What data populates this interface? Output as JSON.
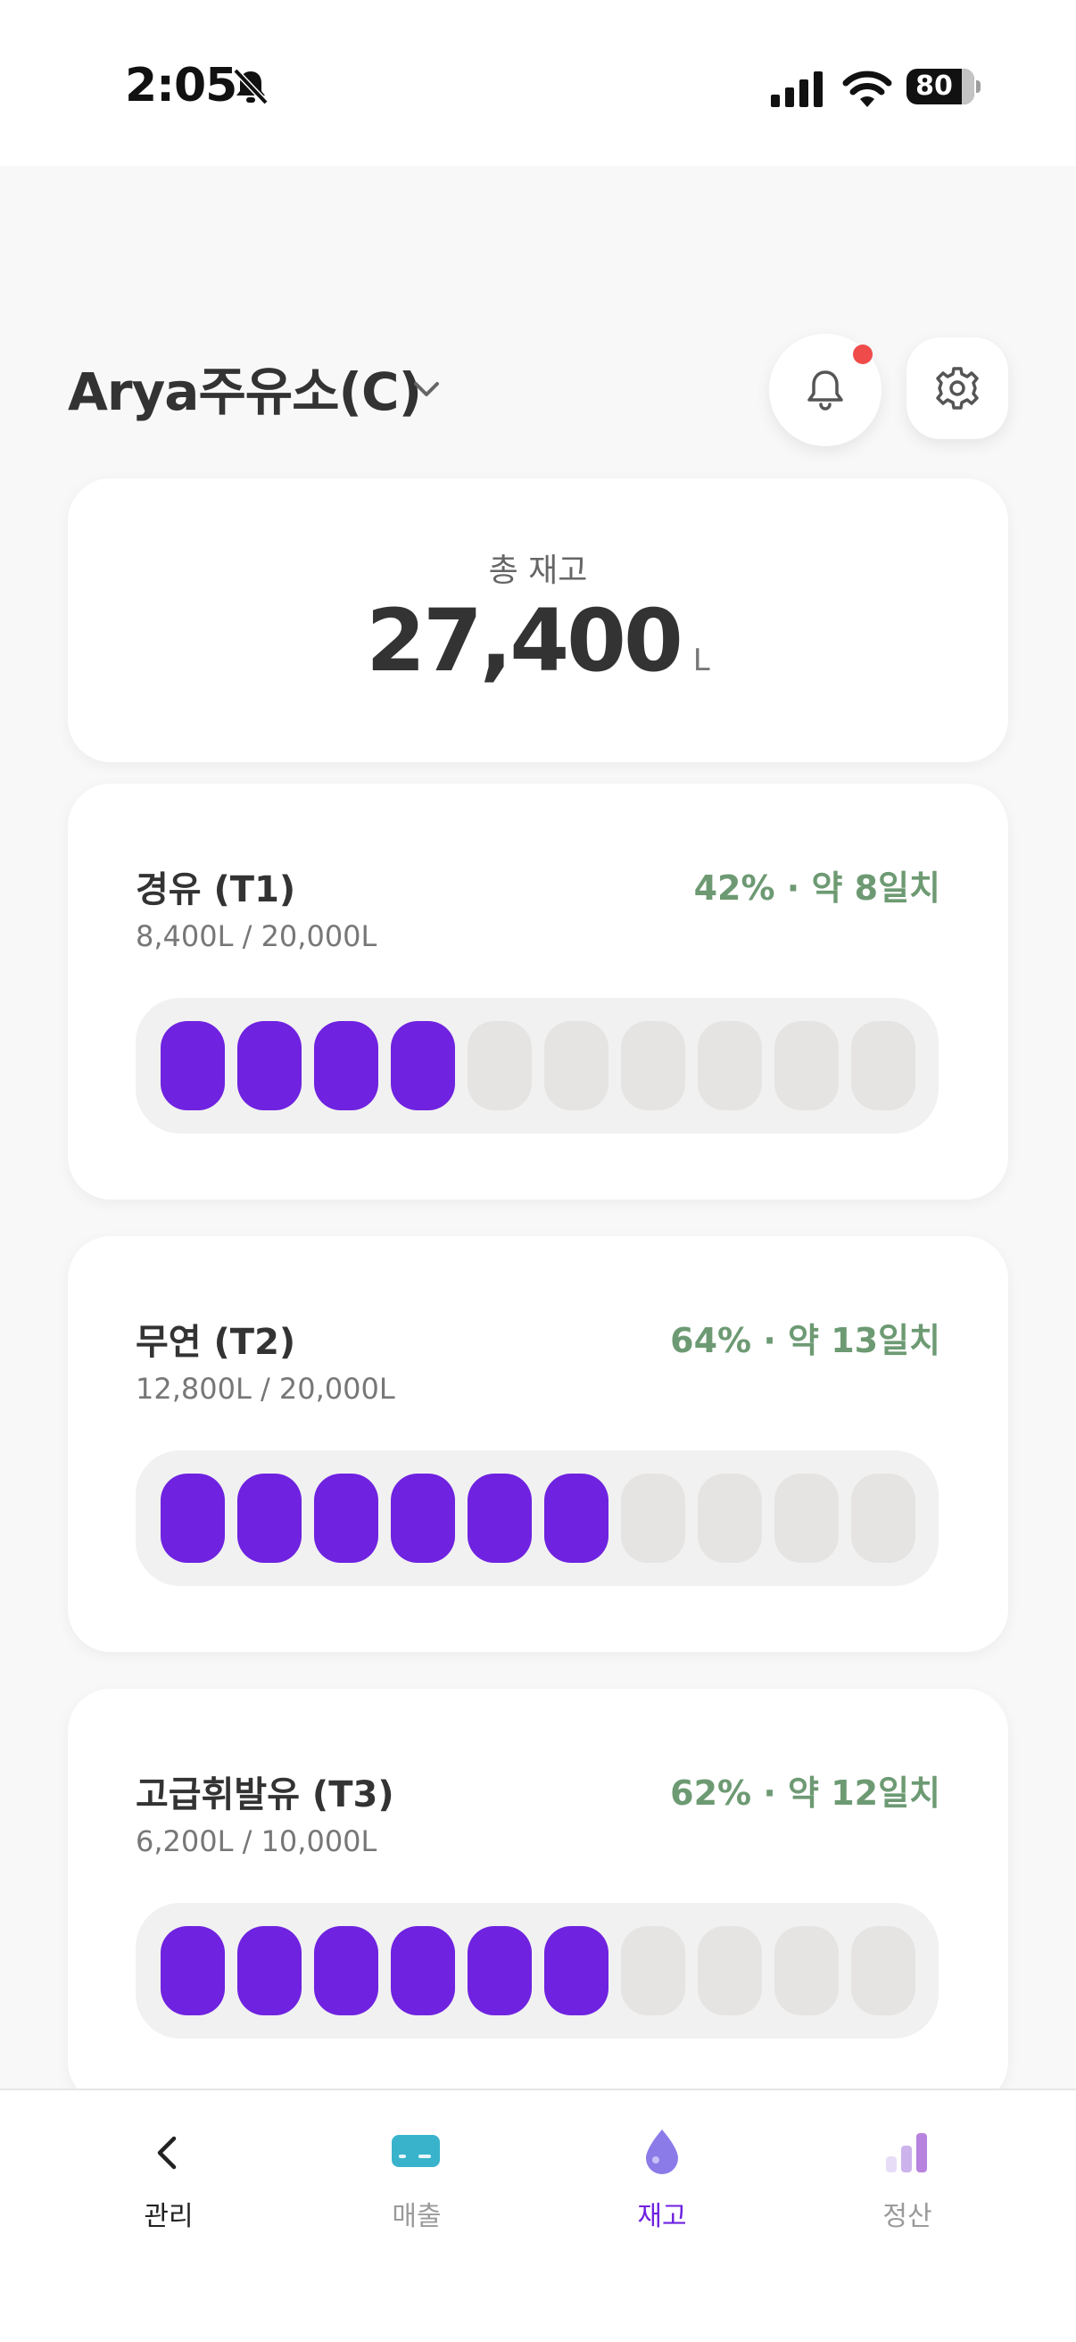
{
  "status_bar": {
    "time": "2:05",
    "battery": "80",
    "battery_level_percent": 80,
    "icons": [
      "bell-slash-icon",
      "cellular-signal-icon",
      "wifi-icon",
      "battery-icon"
    ]
  },
  "header": {
    "station_name": "Arya주유소(C)",
    "notification_dot_color": "#f04b4b"
  },
  "total": {
    "label": "총 재고",
    "value": "27,400",
    "unit": "L"
  },
  "tanks": [
    {
      "name": "경유 (T1)",
      "status": "42% · 약 8일치",
      "capacity": "8,400L / 20,000L",
      "filled_segments": 4,
      "total_segments": 10
    },
    {
      "name": "무연 (T2)",
      "status": "64% · 약 13일치",
      "capacity": "12,800L / 20,000L",
      "filled_segments": 6,
      "total_segments": 10
    },
    {
      "name": "고급휘발유 (T3)",
      "status": "62% · 약 12일치",
      "capacity": "6,200L / 10,000L",
      "filled_segments": 6,
      "total_segments": 10
    }
  ],
  "nav": [
    {
      "label": "관리",
      "icon": "chevron-left-icon",
      "color": "#222222"
    },
    {
      "label": "매출",
      "icon": "card-icon",
      "color": "#9a9a9a"
    },
    {
      "label": "재고",
      "icon": "droplet-icon",
      "color": "#6f22e0",
      "active": true
    },
    {
      "label": "정산",
      "icon": "bar-chart-icon",
      "color": "#9a9a9a"
    }
  ],
  "colors": {
    "accent": "#6f22e0",
    "status_green": "#6d9a73",
    "segment_empty": "#e5e4e2"
  }
}
